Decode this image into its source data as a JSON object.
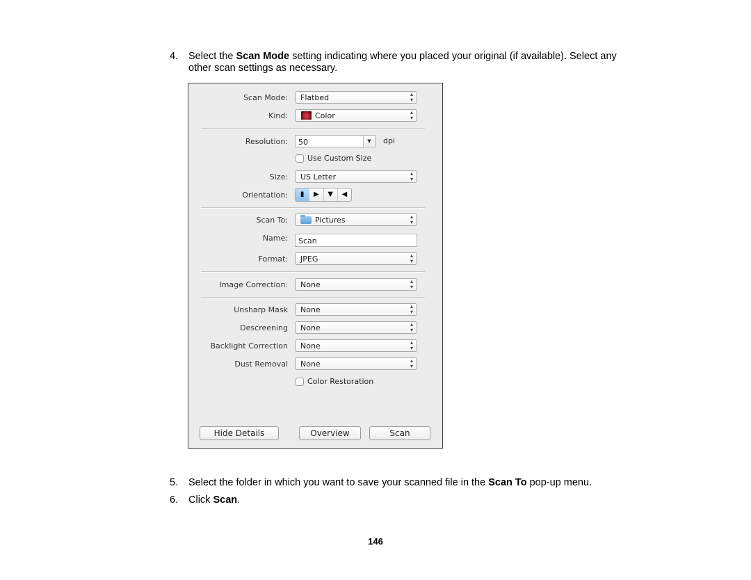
{
  "steps": [
    {
      "number": "4.",
      "before": "Select the ",
      "bold": "Scan Mode",
      "after": " setting indicating where you placed your original (if available). Select any",
      "line2": "other scan settings as necessary."
    },
    {
      "number": "5.",
      "before": "Select the folder in which you want to save your scanned file in the ",
      "bold": "Scan To",
      "after": " pop-up menu."
    },
    {
      "number": "6.",
      "before": "Click ",
      "bold": "Scan",
      "after": "."
    }
  ],
  "dialog": {
    "scan_mode": {
      "label": "Scan Mode:",
      "value": "Flatbed"
    },
    "kind": {
      "label": "Kind:",
      "value": "Color",
      "icon": "color-photo-icon"
    },
    "resolution": {
      "label": "Resolution:",
      "value": "50",
      "unit": "dpi"
    },
    "use_custom_size": {
      "label": "Use Custom Size",
      "checked": false
    },
    "size": {
      "label": "Size:",
      "value": "US Letter"
    },
    "orientation": {
      "label": "Orientation:",
      "options": [
        {
          "name": "orientation-upright",
          "glyph": "▮",
          "selected": true
        },
        {
          "name": "orientation-left",
          "glyph": "▶",
          "selected": false
        },
        {
          "name": "orientation-upside-down",
          "glyph": "▼",
          "selected": false
        },
        {
          "name": "orientation-right",
          "glyph": "◀",
          "selected": false
        }
      ]
    },
    "scan_to": {
      "label": "Scan To:",
      "value": "Pictures",
      "icon": "folder-icon"
    },
    "name": {
      "label": "Name:",
      "value": "Scan"
    },
    "format": {
      "label": "Format:",
      "value": "JPEG"
    },
    "image_correction": {
      "label": "Image Correction:",
      "value": "None"
    },
    "unsharp_mask": {
      "label": "Unsharp Mask",
      "value": "None"
    },
    "descreening": {
      "label": "Descreening",
      "value": "None"
    },
    "backlight_correction": {
      "label": "Backlight Correction",
      "value": "None"
    },
    "dust_removal": {
      "label": "Dust Removal",
      "value": "None"
    },
    "color_restoration": {
      "label": "Color Restoration",
      "checked": false
    },
    "buttons": {
      "hide_details": "Hide Details",
      "overview": "Overview",
      "scan": "Scan"
    },
    "popup_arrows": {
      "up": "▴",
      "down": "▾"
    },
    "combo_arrow": "▼"
  },
  "page_number": "146"
}
